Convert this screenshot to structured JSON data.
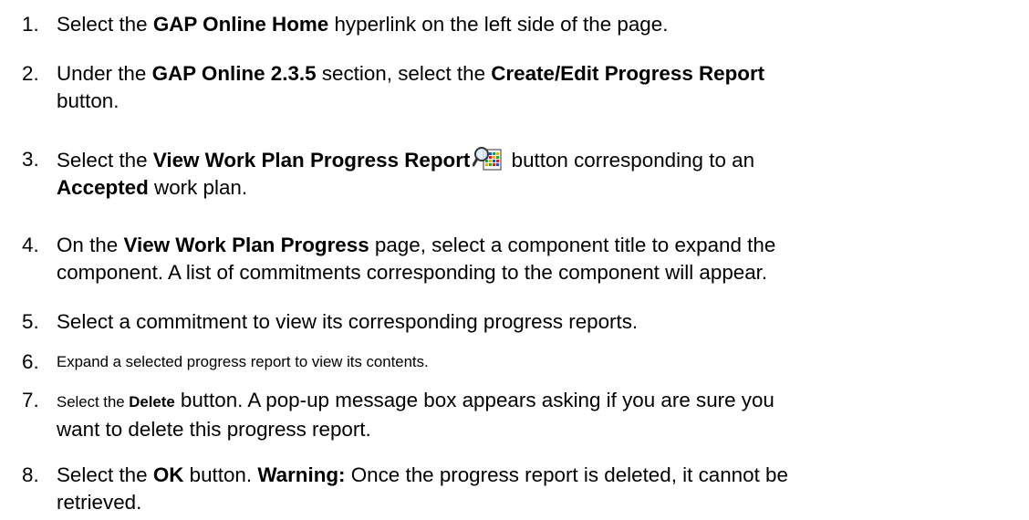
{
  "steps": [
    {
      "number": "1.",
      "pre": "Select the ",
      "bold": "GAP Online Home",
      "post": " hyperlink on the left side of the page."
    },
    {
      "number": "2.",
      "pre": "Under the ",
      "bold1": "GAP Online 2.3.5",
      "mid": " section, select the ",
      "bold2": "Create/Edit Progress Report",
      "line2": "button."
    },
    {
      "number": "3.",
      "pre": "Select the ",
      "bold1": "View Work Plan Progress Report",
      "post": " button corresponding to an",
      "bold2": "Accepted",
      "post2": " work plan.",
      "icon": "view-progress-report-icon"
    },
    {
      "number": "4.",
      "pre": "On the ",
      "bold": "View Work Plan Progress",
      "post": " page, select a component title to expand the",
      "line2": "component. A list of commitments corresponding to the component will appear."
    },
    {
      "number": "5.",
      "text": "Select a commitment to view its corresponding progress reports."
    },
    {
      "number": "6.",
      "text": "Expand a selected progress report to view its contents."
    },
    {
      "number": "7.",
      "pre": "Select the ",
      "bold": "Delete",
      "post": " button. A pop-up message box appears asking if you are sure you",
      "line2": "want to delete this progress report."
    },
    {
      "number": "8.",
      "pre": "Select the ",
      "bold1": "OK",
      "mid": " button. ",
      "bold2": "Warning:",
      "post": " Once the progress report is deleted, it cannot be",
      "line2": "retrieved."
    }
  ]
}
